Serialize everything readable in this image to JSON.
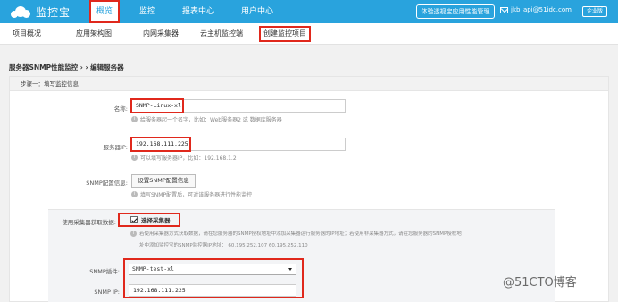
{
  "brand": {
    "name": "监控宝"
  },
  "topnav": {
    "items": [
      {
        "label": "概览"
      },
      {
        "label": "监控"
      },
      {
        "label": "报表中心"
      },
      {
        "label": "用户中心"
      }
    ],
    "experience_button": "体验透视宝应用性能管理",
    "user": "jkb_api@51idc.com",
    "edition": "企业版"
  },
  "subnav": {
    "items": [
      {
        "label": "项目概况"
      },
      {
        "label": "应用架构图"
      },
      {
        "label": "内网采集器"
      },
      {
        "label": "云主机监控端"
      },
      {
        "label": "创建监控项目"
      }
    ]
  },
  "breadcrumb": "服务器SNMP性能监控 › › 编辑服务器",
  "form": {
    "step_title": "步骤一：填写监控信息",
    "name_label": "名称:",
    "name_value": "SNMP-Linux-xl",
    "name_hint": "给服务器起一个名字，比如：Web服务器2 或 数据库服务器",
    "ip_label": "服务器IP:",
    "ip_value": "192.168.111.225",
    "ip_hint": "可以填写服务器IP，比如：192.168.1.2",
    "snmp_label": "SNMP配置信息:",
    "snmp_button": "设置SNMP配置信息",
    "snmp_hint": "填写SNMP配置后，可对该服务器进行性能监控",
    "collector_label": "使用采集器获取数据:",
    "collector_checkbox": "选择采集器",
    "collector_hint_1": "若使用采集器方式获取数据，请在您服务器的SNMP授权地址中添加采集器运行服务器的IP地址；若使用非采集器方式，请在您服务器的SNMP授权地",
    "collector_hint_2": "址中添加监控宝的SNMP监控器IP地址： 60.195.252.107 60.195.252.110",
    "plugin_label": "SNMP插件:",
    "plugin_value": "SNMP-test-xl",
    "snmp_ip_label": "SNMP IP:",
    "snmp_ip_value": "192.168.111.225"
  },
  "watermark": "@51CTO博客"
}
